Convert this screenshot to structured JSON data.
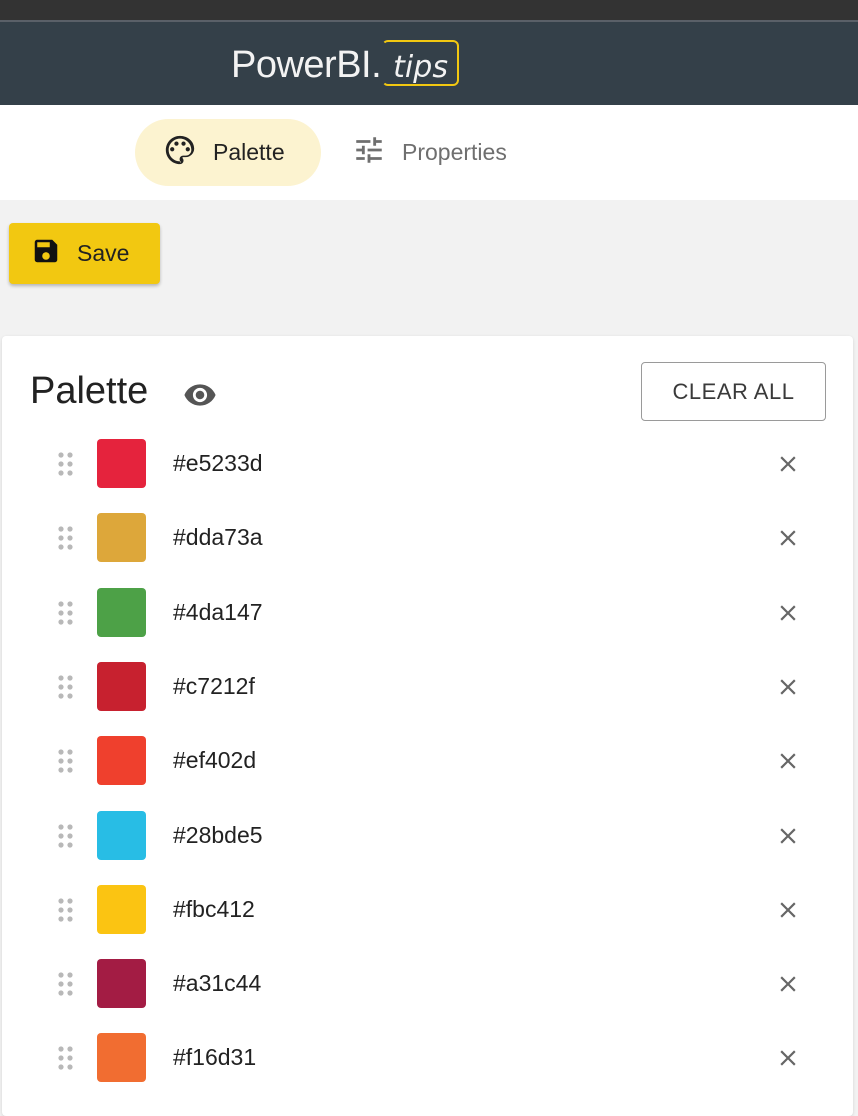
{
  "app": {
    "logo_main": "PowerBI.",
    "logo_tips": "tips",
    "accent_color": "#f2c811",
    "header_color": "#344049"
  },
  "nav": {
    "tabs": [
      {
        "label": "Palette",
        "icon": "palette-icon",
        "active": true
      },
      {
        "label": "Properties",
        "icon": "tune-icon",
        "active": false
      }
    ]
  },
  "toolbar": {
    "save_label": "Save",
    "save_icon": "floppy-disk-icon"
  },
  "palette": {
    "title": "Palette",
    "visibility_icon": "eye-icon",
    "clear_label": "CLEAR ALL",
    "colors": [
      {
        "hex": "#e5233d"
      },
      {
        "hex": "#dda73a"
      },
      {
        "hex": "#4da147"
      },
      {
        "hex": "#c7212f"
      },
      {
        "hex": "#ef402d"
      },
      {
        "hex": "#28bde5"
      },
      {
        "hex": "#fbc412"
      },
      {
        "hex": "#a31c44"
      },
      {
        "hex": "#f16d31"
      }
    ]
  }
}
